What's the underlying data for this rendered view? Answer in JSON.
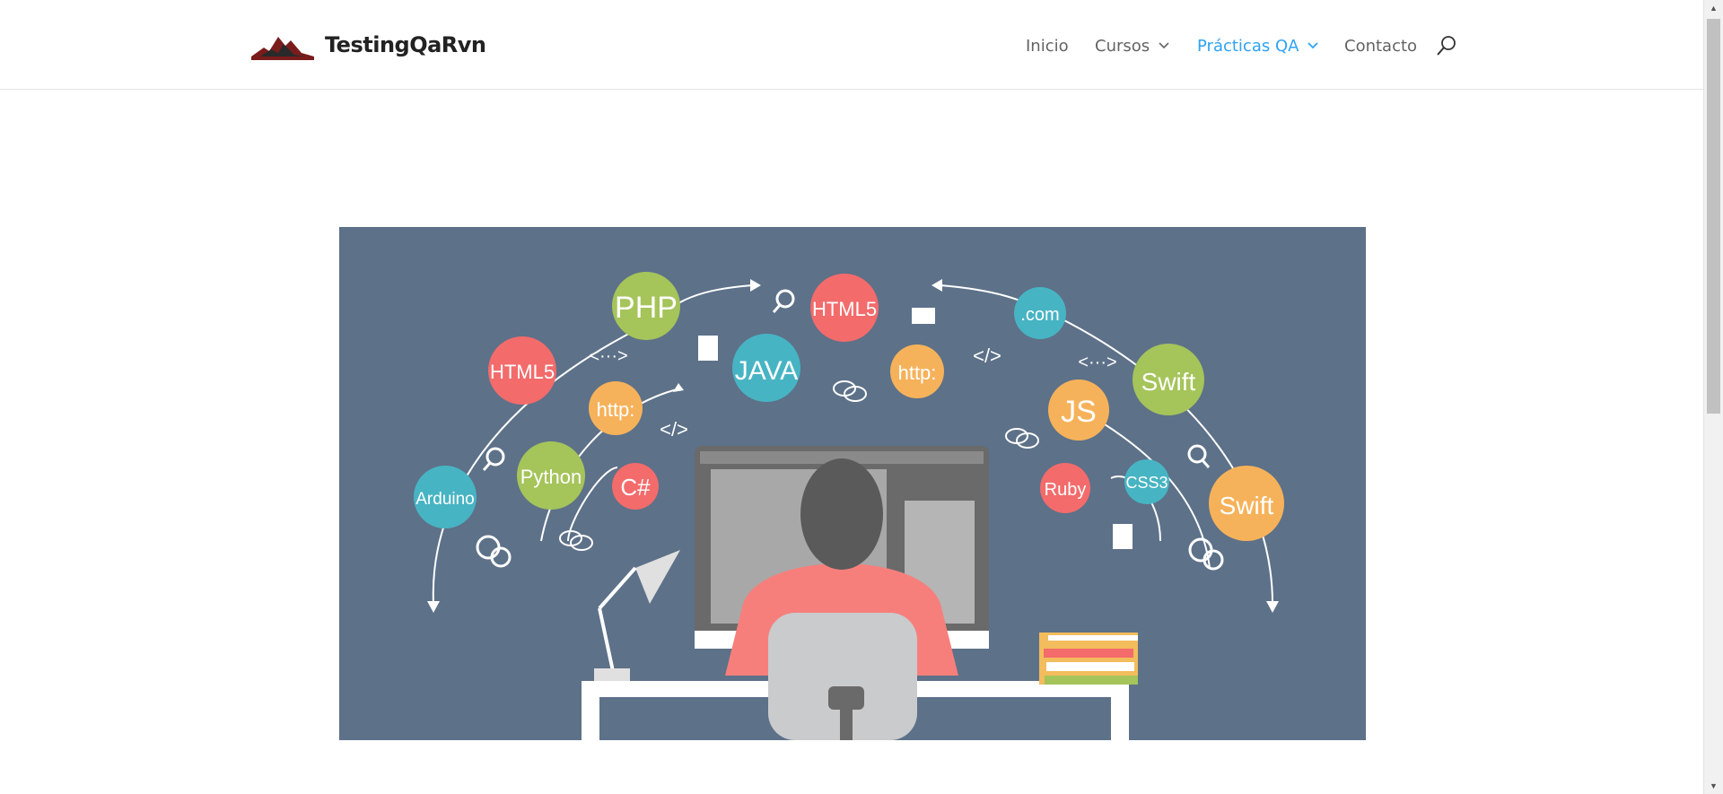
{
  "header": {
    "logo_text": "TestingQaRvn",
    "nav": [
      {
        "label": "Inicio"
      },
      {
        "label": "Cursos"
      },
      {
        "label": "Prácticas QA"
      },
      {
        "label": "Contacto"
      }
    ],
    "accent_color": "#2ea3f2"
  },
  "hero": {
    "bubbles": {
      "php": "PHP",
      "html5_top": "HTML5",
      "dotcom": ".com",
      "html5_left": "HTML5",
      "java": "JAVA",
      "http_center": "http:",
      "swift_top": "Swift",
      "http_left": "http:",
      "js": "JS",
      "python": "Python",
      "csharp": "C#",
      "ruby": "Ruby",
      "css3": "CSS3",
      "arduino": "Arduino",
      "swift_right": "Swift"
    },
    "code_tags": {
      "tag1": "<···>",
      "tag2": "</>",
      "tag3": "</>",
      "tag4": "<···>"
    },
    "background_color": "#5d7189"
  }
}
